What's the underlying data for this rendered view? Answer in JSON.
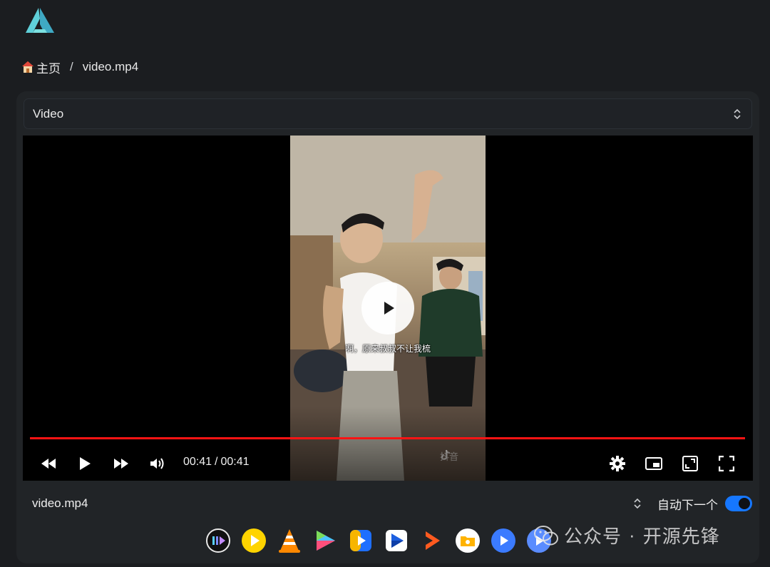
{
  "breadcrumb": {
    "home_label": "主页",
    "separator": "/",
    "current": "video.mp4"
  },
  "source_select": {
    "value": "Video"
  },
  "player": {
    "subtitle": "啊，原来叔叔不让我梳",
    "watermark": "抖音",
    "current_time": "00:41",
    "time_separator": "/",
    "duration": "00:41",
    "progress": 1.0,
    "colors": {
      "progress": "#ff1414",
      "background": "#000000"
    }
  },
  "footer": {
    "filename": "video.mp4",
    "autoplay_label": "自动下一个",
    "autoplay_on": true
  },
  "apps": [
    {
      "icon": "iina-icon"
    },
    {
      "icon": "potplayer-icon"
    },
    {
      "icon": "vlc-icon"
    },
    {
      "icon": "nplayer-icon"
    },
    {
      "icon": "infuse-icon"
    },
    {
      "icon": "mxplayer-icon"
    },
    {
      "icon": "mxplayer-pro-icon"
    },
    {
      "icon": "fileball-icon"
    },
    {
      "icon": "omniplayer-icon"
    },
    {
      "icon": "figplayer-icon"
    }
  ],
  "watermark_overlay": {
    "account": "公众号",
    "dot": "·",
    "name": "开源先锋"
  },
  "colors": {
    "accent": "#1677ff",
    "page_bg": "#1b1d20",
    "card_bg": "#212427"
  }
}
